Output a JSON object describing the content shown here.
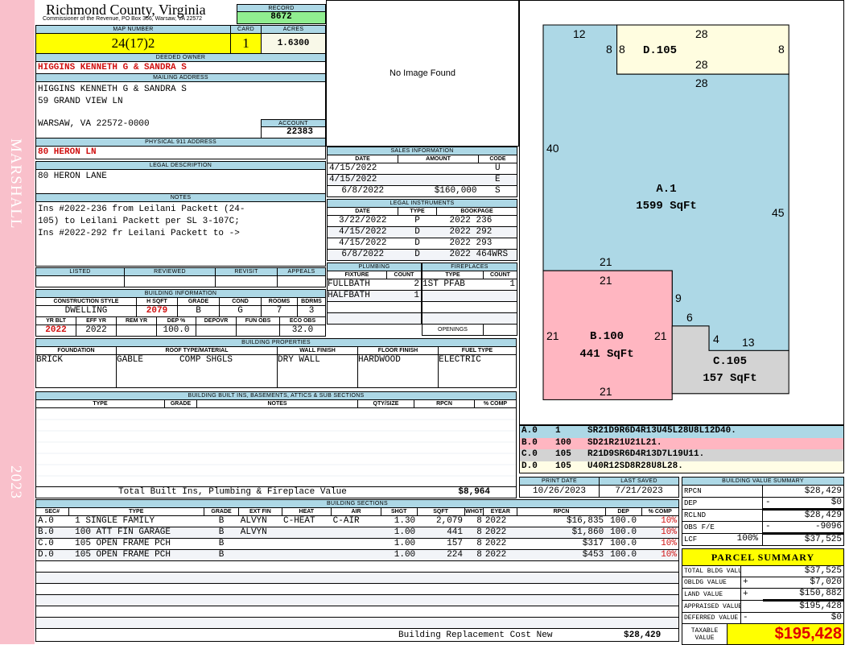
{
  "sidebar": {
    "name": "MARSHALL",
    "year": "2023"
  },
  "header": {
    "title": "Richmond County, Virginia",
    "subtitle": "Commissioner of the Revenue, PO Box 366, Warsaw, VA 22572",
    "record_label": "RECORD",
    "record": "8672"
  },
  "parcel": {
    "map_label": "MAP NUMBER",
    "map": "24(17)2",
    "card_label": "CARD",
    "card": "1",
    "acres_label": "ACRES",
    "acres": "1.6300"
  },
  "owner": {
    "label": "DEEDED OWNER",
    "value": "HIGGINS KENNETH G & SANDRA S"
  },
  "mailing": {
    "label": "MAILING ADDRESS",
    "line1": "HIGGINS KENNETH G & SANDRA S",
    "line2": "59 GRAND VIEW LN",
    "line3": "WARSAW, VA 22572-0000",
    "account_label": "ACCOUNT",
    "account": "22383"
  },
  "physical": {
    "label": "PHYSICAL 911 ADDRESS",
    "value": "80 HERON LN"
  },
  "legal_desc": {
    "label": "LEGAL DESCRIPTION",
    "value": "80 HERON LANE"
  },
  "notes": {
    "label": "NOTES",
    "line1": "Ins #2022-236 from Leilani Packett (24-",
    "line2": "105) to Leilani Packett per SL 3-107C;",
    "line3": "Ins #2022-292 fr Leilani Packett to ->"
  },
  "review": {
    "listed": "LISTED",
    "reviewed": "REVIEWED",
    "revisit": "REVISIT",
    "appeals": "APPEALS"
  },
  "building_info": {
    "label": "BUILDING INFORMATION",
    "h1": [
      "CONSTRUCTION STYLE",
      "H SQFT",
      "GRADE",
      "COND",
      "ROOMS",
      "BDRMS"
    ],
    "v1": [
      "DWELLING",
      "2079",
      "B",
      "G",
      "7",
      "3"
    ],
    "h2": [
      "YR BLT",
      "EFF YR",
      "REM YR",
      "DEP %",
      "DEPOVR",
      "FUN OBS",
      "ECO OBS"
    ],
    "v2": [
      "2022",
      "2022",
      "",
      "100.0",
      "",
      "",
      "32.0"
    ]
  },
  "building_props": {
    "label": "BUILDING PROPERTIES",
    "headers": [
      "FOUNDATION",
      "ROOF TYPE/MATERIAL",
      "WALL FINISH",
      "FLOOR FINISH",
      "FUEL TYPE"
    ],
    "foundation": "BRICK",
    "roof_type": "GABLE",
    "roof_material": "COMP SHGLS",
    "wall": "DRY WALL",
    "floor": "HARDWOOD",
    "fuel": "ELECTRIC"
  },
  "built_ins": {
    "label": "BUILDING BUILT INS, BASEMENTS, ATTICS & SUB SECTIONS",
    "headers": [
      "TYPE",
      "GRADE",
      "NOTES",
      "QTY/SIZE",
      "RPCN",
      "% COMP"
    ],
    "total_label": "Total Built Ins, Plumbing & Fireplace Value",
    "total": "$8,964"
  },
  "image": {
    "placeholder": "No Image Found"
  },
  "sales": {
    "label": "SALES INFORMATION",
    "headers": [
      "DATE",
      "AMOUNT",
      "CODE"
    ],
    "rows": [
      {
        "date": "4/15/2022",
        "amount": "",
        "code": "U"
      },
      {
        "date": "4/15/2022",
        "amount": "",
        "code": "E"
      },
      {
        "date": "6/8/2022",
        "amount": "$160,000",
        "code": "S"
      }
    ]
  },
  "legal": {
    "label": "LEGAL INSTRUMENTS",
    "headers": [
      "DATE",
      "TYPE",
      "BOOKPAGE"
    ],
    "rows": [
      {
        "date": "3/22/2022",
        "type": "P",
        "book": "2022 236"
      },
      {
        "date": "4/15/2022",
        "type": "D",
        "book": "2022 292"
      },
      {
        "date": "4/15/2022",
        "type": "D",
        "book": "2022 293"
      },
      {
        "date": "6/8/2022",
        "type": "D",
        "book": "2022 464WRS"
      }
    ]
  },
  "plumbing": {
    "label": "PLUMBING",
    "headers": [
      "FIXTURE",
      "COUNT"
    ],
    "rows": [
      {
        "fixture": "FULLBATH",
        "count": "2"
      },
      {
        "fixture": "HALFBATH",
        "count": "1"
      }
    ]
  },
  "fireplaces": {
    "label": "FIREPLACES",
    "headers": [
      "TYPE",
      "COUNT"
    ],
    "rows": [
      {
        "type": "1ST PFAB",
        "count": "1"
      }
    ],
    "openings": "OPENINGS"
  },
  "sketch": {
    "a_name": "A.1",
    "a_area": "1599 SqFt",
    "b_name": "B.100",
    "b_area": "441 SqFt",
    "c_name": "C.105",
    "c_area": "157 SqFt",
    "d_name": "D.105",
    "dims": {
      "a_top": "12",
      "a_8": "8",
      "d_8l": "8",
      "d_28t": "28",
      "d_8r": "8",
      "d_28b": "28",
      "a_28": "28",
      "a_40": "40",
      "a_45": "45",
      "a_21": "21",
      "b_21t": "21",
      "b_21l": "21",
      "b_21r": "21",
      "b_21b": "21",
      "c_9": "9",
      "c_6": "6",
      "c_4": "4",
      "c_13": "13"
    },
    "codes": [
      {
        "sec": "A.0",
        "code": "1",
        "path": "SR21D9R6D4R13U45L28U8L12D40.",
        "color": "#add8e6"
      },
      {
        "sec": "B.0",
        "code": "100",
        "path": "SD21R21U21L21.",
        "color": "#ffb6c1"
      },
      {
        "sec": "C.0",
        "code": "105",
        "path": "R21D9SR6D4R13D7L19U11.",
        "color": "#d3d3d3"
      },
      {
        "sec": "D.0",
        "code": "105",
        "path": "U40R12SD8R28U8L28.",
        "color": "#fffde6"
      }
    ]
  },
  "dates": {
    "print_label": "PRINT DATE",
    "print": "10/26/2023",
    "saved_label": "LAST SAVED",
    "saved": "7/21/2023"
  },
  "sections": {
    "label": "BUILDING SECTIONS",
    "headers": [
      "SEC#",
      "TYPE",
      "GRADE",
      "EXT FIN",
      "HEAT",
      "AIR",
      "SHGT",
      "SQFT",
      "WHGT",
      "EYEAR",
      "RPCN",
      "DEP",
      "% COMP"
    ],
    "rows": [
      {
        "sec": "A.0",
        "type": "1 SINGLE FAMILY",
        "grade": "B",
        "ext": "ALVYN",
        "heat": "C-HEAT",
        "air": "C-AIR",
        "shgt": "1.30",
        "sqft": "2,079",
        "whgt": "8",
        "eyear": "2022",
        "rpcn": "$16,835",
        "dep": "100.0",
        "comp": "10%"
      },
      {
        "sec": "B.0",
        "type": "100 ATT FIN GARAGE",
        "grade": "B",
        "ext": "ALVYN",
        "heat": "",
        "air": "",
        "shgt": "1.00",
        "sqft": "441",
        "whgt": "8",
        "eyear": "2022",
        "rpcn": "$1,860",
        "dep": "100.0",
        "comp": "10%"
      },
      {
        "sec": "C.0",
        "type": "105 OPEN FRAME PCH",
        "grade": "B",
        "ext": "",
        "heat": "",
        "air": "",
        "shgt": "1.00",
        "sqft": "157",
        "whgt": "8",
        "eyear": "2022",
        "rpcn": "$317",
        "dep": "100.0",
        "comp": "10%"
      },
      {
        "sec": "D.0",
        "type": "105 OPEN FRAME PCH",
        "grade": "B",
        "ext": "",
        "heat": "",
        "air": "",
        "shgt": "1.00",
        "sqft": "224",
        "whgt": "8",
        "eyear": "2022",
        "rpcn": "$453",
        "dep": "100.0",
        "comp": "10%"
      }
    ],
    "total_label": "Building Replacement Cost New",
    "total": "$28,429"
  },
  "value_summary": {
    "label": "BUILDING VALUE SUMMARY",
    "rows": [
      {
        "label": "RPCN",
        "op": "",
        "value": "$28,429"
      },
      {
        "label": "DEP",
        "op": "-",
        "value": "$0"
      },
      {
        "label": "RCLND",
        "op": "",
        "value": "$28,429"
      },
      {
        "label": "OBS F/E",
        "op": "-",
        "value": "-9096"
      },
      {
        "label": "LCF",
        "pct": "100%",
        "op": "",
        "value": "$37,525"
      }
    ]
  },
  "parcel_summary": {
    "label": "PARCEL SUMMARY",
    "rows": [
      {
        "label": "TOTAL BLDG VALUE",
        "op": "",
        "value": "$37,525"
      },
      {
        "label": "OBLDG VALUE",
        "op": "+",
        "value": "$7,020"
      },
      {
        "label": "LAND VALUE",
        "op": "+",
        "value": "$150,882"
      },
      {
        "label": "APPRAISED VALUE",
        "op": "",
        "value": "$195,428"
      },
      {
        "label": "DEFERRED VALUE",
        "op": "-",
        "value": "$0"
      }
    ],
    "taxable_label": "TAXABLE VALUE",
    "taxable": "$195,428"
  },
  "colors": {
    "header": "#add8e6",
    "yellow": "#ffff00",
    "record": "#90ee90",
    "red": "#d01010",
    "strip": "#f9c0cb"
  }
}
